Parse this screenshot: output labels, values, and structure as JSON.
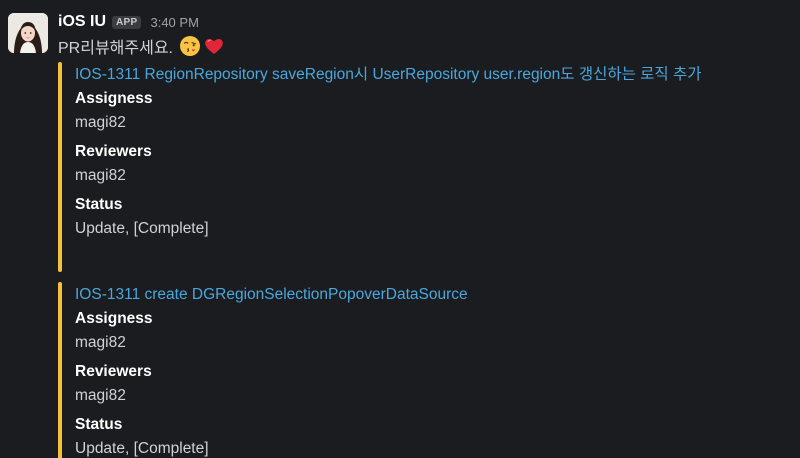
{
  "sender": {
    "name": "iOS IU",
    "badge": "APP",
    "time": "3:40 PM"
  },
  "message": {
    "text": "PR리뷰해주세요.",
    "emojis": [
      "face-blowing-kiss-icon",
      "red-heart-icon"
    ]
  },
  "colors": {
    "background": "#1b1c1f",
    "attachment_bar": "#f3c13a",
    "link": "#4aa7dd"
  },
  "attachments": [
    {
      "title": "IOS-1311 RegionRepository saveRegion시 UserRepository user.region도 갱신하는 로직 추가",
      "fields": [
        {
          "label": "Assigness",
          "value": "magi82"
        },
        {
          "label": "Reviewers",
          "value": "magi82"
        },
        {
          "label": "Status",
          "value": "Update, [Complete]"
        }
      ]
    },
    {
      "title": "IOS-1311 create DGRegionSelectionPopoverDataSource",
      "fields": [
        {
          "label": "Assigness",
          "value": "magi82"
        },
        {
          "label": "Reviewers",
          "value": "magi82"
        },
        {
          "label": "Status",
          "value": "Update, [Complete]"
        }
      ]
    }
  ]
}
